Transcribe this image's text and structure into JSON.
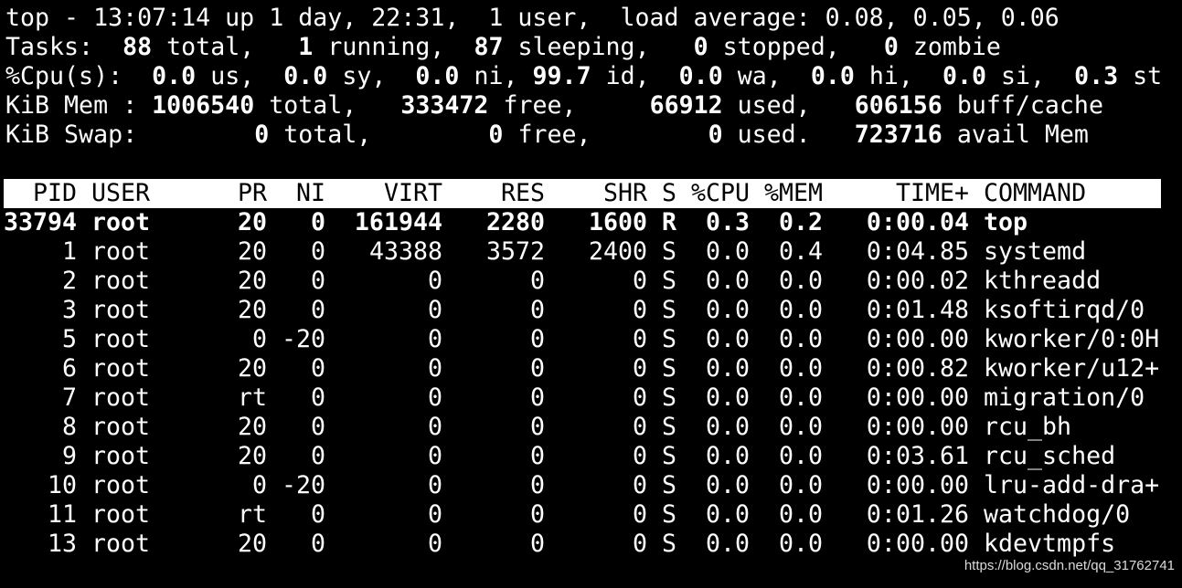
{
  "summary": {
    "line1": "top - 13:07:14 up 1 day, 22:31,  1 user,  load average: 0.08, 0.05, 0.06",
    "tasks": {
      "label": "Tasks:",
      "total": "88",
      "total_l": "total,",
      "running": "1",
      "running_l": "running,",
      "sleeping": "87",
      "sleeping_l": "sleeping,",
      "stopped": "0",
      "stopped_l": "stopped,",
      "zombie": "0",
      "zombie_l": "zombie"
    },
    "cpu": {
      "label": "%Cpu(s):",
      "us": "0.0",
      "us_l": "us,",
      "sy": "0.0",
      "sy_l": "sy,",
      "ni": "0.0",
      "ni_l": "ni,",
      "id": "99.7",
      "id_l": "id,",
      "wa": "0.0",
      "wa_l": "wa,",
      "hi": "0.0",
      "hi_l": "hi,",
      "si": "0.0",
      "si_l": "si,",
      "st": "0.3",
      "st_l": "st"
    },
    "mem": {
      "label": "KiB Mem :",
      "total": "1006540",
      "total_l": "total,",
      "free": "333472",
      "free_l": "free,",
      "used": "66912",
      "used_l": "used,",
      "buff": "606156",
      "buff_l": "buff/cache"
    },
    "swap": {
      "label": "KiB Swap:",
      "total": "0",
      "total_l": "total,",
      "free": "0",
      "free_l": "free,",
      "used": "0",
      "used_l": "used.",
      "avail": "723716",
      "avail_l": "avail Mem"
    }
  },
  "columns": [
    "PID",
    "USER",
    "PR",
    "NI",
    "VIRT",
    "RES",
    "SHR",
    "S",
    "%CPU",
    "%MEM",
    "TIME+",
    "COMMAND"
  ],
  "processes": [
    {
      "pid": "33794",
      "user": "root",
      "pr": "20",
      "ni": "0",
      "virt": "161944",
      "res": "2280",
      "shr": "1600",
      "s": "R",
      "cpu": "0.3",
      "mem": "0.2",
      "time": "0:00.04",
      "cmd": "top"
    },
    {
      "pid": "1",
      "user": "root",
      "pr": "20",
      "ni": "0",
      "virt": "43388",
      "res": "3572",
      "shr": "2400",
      "s": "S",
      "cpu": "0.0",
      "mem": "0.4",
      "time": "0:04.85",
      "cmd": "systemd"
    },
    {
      "pid": "2",
      "user": "root",
      "pr": "20",
      "ni": "0",
      "virt": "0",
      "res": "0",
      "shr": "0",
      "s": "S",
      "cpu": "0.0",
      "mem": "0.0",
      "time": "0:00.02",
      "cmd": "kthreadd"
    },
    {
      "pid": "3",
      "user": "root",
      "pr": "20",
      "ni": "0",
      "virt": "0",
      "res": "0",
      "shr": "0",
      "s": "S",
      "cpu": "0.0",
      "mem": "0.0",
      "time": "0:01.48",
      "cmd": "ksoftirqd/0"
    },
    {
      "pid": "5",
      "user": "root",
      "pr": "0",
      "ni": "-20",
      "virt": "0",
      "res": "0",
      "shr": "0",
      "s": "S",
      "cpu": "0.0",
      "mem": "0.0",
      "time": "0:00.00",
      "cmd": "kworker/0:0H"
    },
    {
      "pid": "6",
      "user": "root",
      "pr": "20",
      "ni": "0",
      "virt": "0",
      "res": "0",
      "shr": "0",
      "s": "S",
      "cpu": "0.0",
      "mem": "0.0",
      "time": "0:00.82",
      "cmd": "kworker/u12+"
    },
    {
      "pid": "7",
      "user": "root",
      "pr": "rt",
      "ni": "0",
      "virt": "0",
      "res": "0",
      "shr": "0",
      "s": "S",
      "cpu": "0.0",
      "mem": "0.0",
      "time": "0:00.00",
      "cmd": "migration/0"
    },
    {
      "pid": "8",
      "user": "root",
      "pr": "20",
      "ni": "0",
      "virt": "0",
      "res": "0",
      "shr": "0",
      "s": "S",
      "cpu": "0.0",
      "mem": "0.0",
      "time": "0:00.00",
      "cmd": "rcu_bh"
    },
    {
      "pid": "9",
      "user": "root",
      "pr": "20",
      "ni": "0",
      "virt": "0",
      "res": "0",
      "shr": "0",
      "s": "S",
      "cpu": "0.0",
      "mem": "0.0",
      "time": "0:03.61",
      "cmd": "rcu_sched"
    },
    {
      "pid": "10",
      "user": "root",
      "pr": "0",
      "ni": "-20",
      "virt": "0",
      "res": "0",
      "shr": "0",
      "s": "S",
      "cpu": "0.0",
      "mem": "0.0",
      "time": "0:00.00",
      "cmd": "lru-add-dra+"
    },
    {
      "pid": "11",
      "user": "root",
      "pr": "rt",
      "ni": "0",
      "virt": "0",
      "res": "0",
      "shr": "0",
      "s": "S",
      "cpu": "0.0",
      "mem": "0.0",
      "time": "0:01.26",
      "cmd": "watchdog/0"
    },
    {
      "pid": "13",
      "user": "root",
      "pr": "20",
      "ni": "0",
      "virt": "0",
      "res": "0",
      "shr": "0",
      "s": "S",
      "cpu": "0.0",
      "mem": "0.0",
      "time": "0:00.00",
      "cmd": "kdevtmpfs"
    }
  ],
  "highlight_row": 0,
  "colors": {
    "background": "#000000",
    "text": "#ffffff",
    "header_bg": "#ffffff",
    "header_text": "#000000"
  },
  "watermark": "https://blog.csdn.net/qq_31762741"
}
